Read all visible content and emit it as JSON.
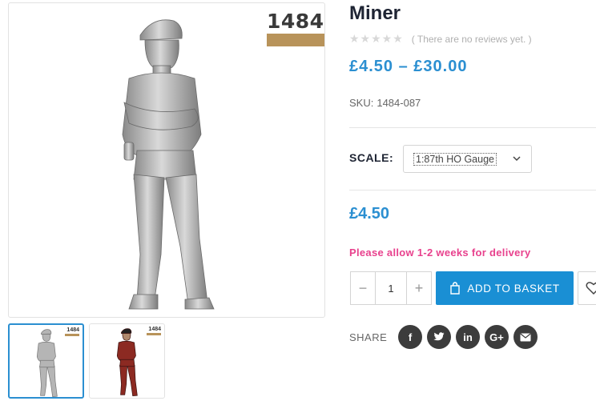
{
  "product": {
    "title": "Miner",
    "reviews_text": "( There are no reviews yet. )",
    "rating_stars": 0,
    "price_range": "£4.50 – £30.00",
    "sku_label": "SKU:",
    "sku_value": "1484-087",
    "price": "£4.50",
    "delivery_note": "Please allow 1-2 weeks for delivery"
  },
  "gallery": {
    "brand_number": "1484",
    "thumb_brand_number": "1484",
    "thumbs": [
      {
        "variant": "grey",
        "color": "#b5b5b5",
        "active": true
      },
      {
        "variant": "red",
        "color": "#8c2a22",
        "active": false
      }
    ]
  },
  "variation": {
    "label": "SCALE:",
    "selected": "1:87th HO Gauge"
  },
  "cart": {
    "quantity": "1",
    "minus": "−",
    "plus": "+",
    "add_label": "ADD TO BASKET"
  },
  "share": {
    "label": "SHARE",
    "icons": [
      "facebook-icon",
      "twitter-icon",
      "linkedin-icon",
      "google-plus-icon",
      "email-icon"
    ],
    "facebook": "f",
    "linkedin": "in",
    "google": "G+"
  },
  "colors": {
    "accent": "#2b8fd1",
    "button": "#1a8fd4",
    "delivery": "#e8418d",
    "brand_bar": "#b8935a",
    "social": "#3c3c3c"
  }
}
